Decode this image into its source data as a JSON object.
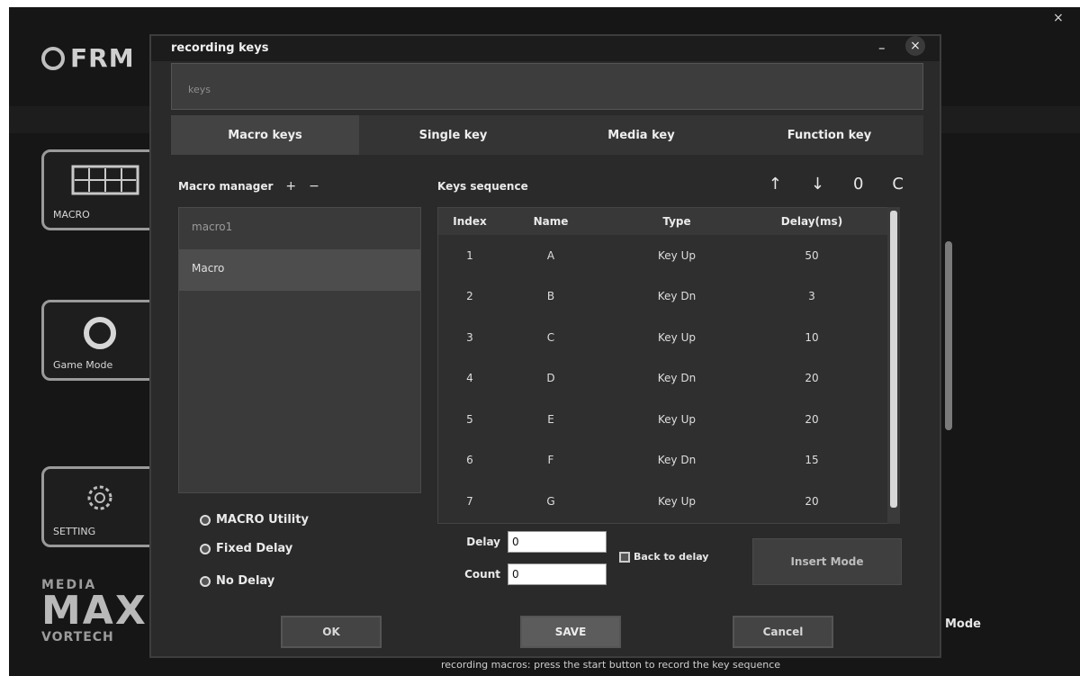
{
  "background_app": {
    "logo_text": "FRM",
    "side_cards": [
      {
        "label": "MACRO",
        "icon": "keyboard-icon"
      },
      {
        "label": "Game Mode",
        "icon": "ring-icon"
      },
      {
        "label": "SETTING",
        "icon": "gear-icon"
      }
    ],
    "brand_top": "MEDIA",
    "brand_main": "MAXF",
    "brand_bottom": "VORTECH",
    "right_text": "Mode",
    "bottom_text": "recording macros: press the start button to record the key sequence",
    "close_label": "×"
  },
  "dialog": {
    "title": "recording keys",
    "band_text": "keys",
    "min_label": "–",
    "close_label": "×",
    "tabs": [
      {
        "label": "Macro keys",
        "active": true
      },
      {
        "label": "Single key",
        "active": false
      },
      {
        "label": "Media key",
        "active": false
      },
      {
        "label": "Function key",
        "active": false
      }
    ],
    "macro_list": {
      "label": "Macro manager",
      "add_symbol": "+",
      "remove_symbol": "−",
      "items": [
        {
          "label": "macro1",
          "muted": true,
          "selected": false
        },
        {
          "label": "Macro",
          "muted": false,
          "selected": true
        }
      ]
    },
    "modes": [
      {
        "label": "MACRO Utility"
      },
      {
        "label": "Fixed Delay"
      },
      {
        "label": "No Delay"
      }
    ],
    "sequence": {
      "label": "Keys sequence",
      "tools": [
        "↑",
        "↓",
        "0",
        "C"
      ],
      "columns": [
        "Index",
        "Name",
        "Type",
        "Delay(ms)"
      ],
      "rows": [
        [
          "1",
          "A",
          "Key Up",
          "50"
        ],
        [
          "2",
          "B",
          "Key Dn",
          "3"
        ],
        [
          "3",
          "C",
          "Key Up",
          "10"
        ],
        [
          "4",
          "D",
          "Key Dn",
          "20"
        ],
        [
          "5",
          "E",
          "Key Up",
          "20"
        ],
        [
          "6",
          "F",
          "Key Dn",
          "15"
        ],
        [
          "7",
          "G",
          "Key Up",
          "20"
        ]
      ]
    },
    "fields": {
      "delay_label": "Delay",
      "delay_value": "0",
      "count_label": "Count",
      "count_value": "0"
    },
    "check_label": "Back to delay",
    "insert_label": "Insert Mode",
    "footer": {
      "ok_label": "OK",
      "save_label": "SAVE",
      "cancel_label": "Cancel"
    }
  }
}
